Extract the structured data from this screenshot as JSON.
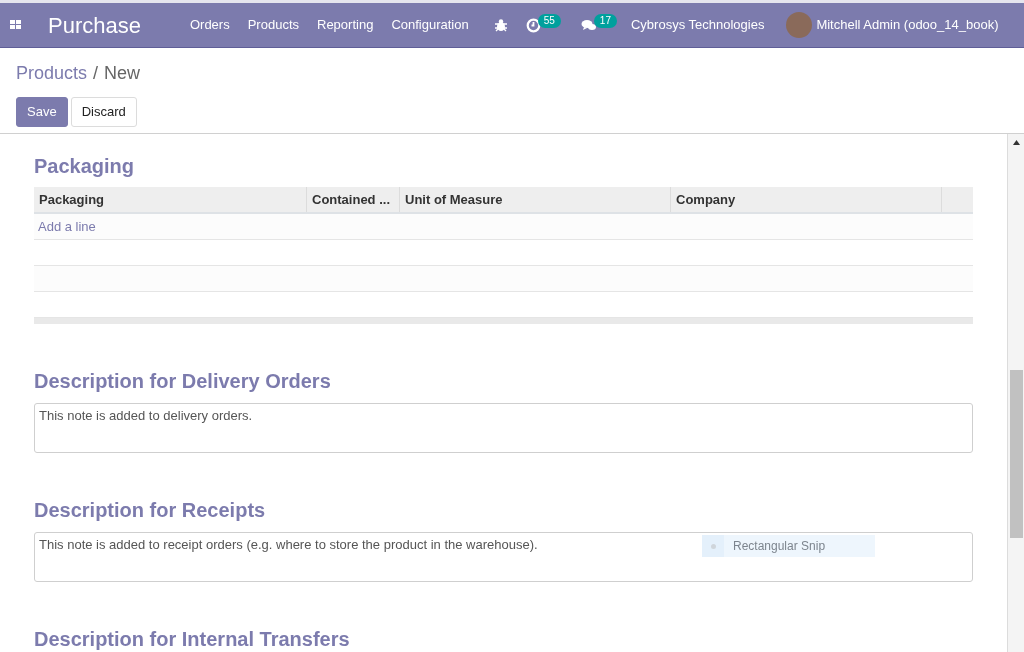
{
  "navbar": {
    "app_name": "Purchase",
    "menu": [
      "Orders",
      "Products",
      "Reporting",
      "Configuration"
    ],
    "activity_count": "55",
    "message_count": "17",
    "company": "Cybrosys Technologies",
    "user": "Mitchell Admin (odoo_14_book)"
  },
  "breadcrumb": {
    "items": [
      "Products",
      "New"
    ],
    "separator": "/"
  },
  "buttons": [
    {
      "label": "Save",
      "kind": "primary"
    },
    {
      "label": "Discard",
      "kind": "secondary"
    }
  ],
  "packaging": {
    "title": "Packaging",
    "columns": [
      "Packaging",
      "Contained ...",
      "Unit of Measure",
      "Company"
    ],
    "add_line": "Add a line"
  },
  "descriptions": [
    {
      "title": "Description for Delivery Orders",
      "placeholder": "This note is added to delivery orders."
    },
    {
      "title": "Description for Receipts",
      "placeholder": "This note is added to receipt orders (e.g. where to store the product in the warehouse)."
    },
    {
      "title": "Description for Internal Transfers"
    }
  ],
  "overlay": {
    "label": "Rectangular Snip"
  }
}
